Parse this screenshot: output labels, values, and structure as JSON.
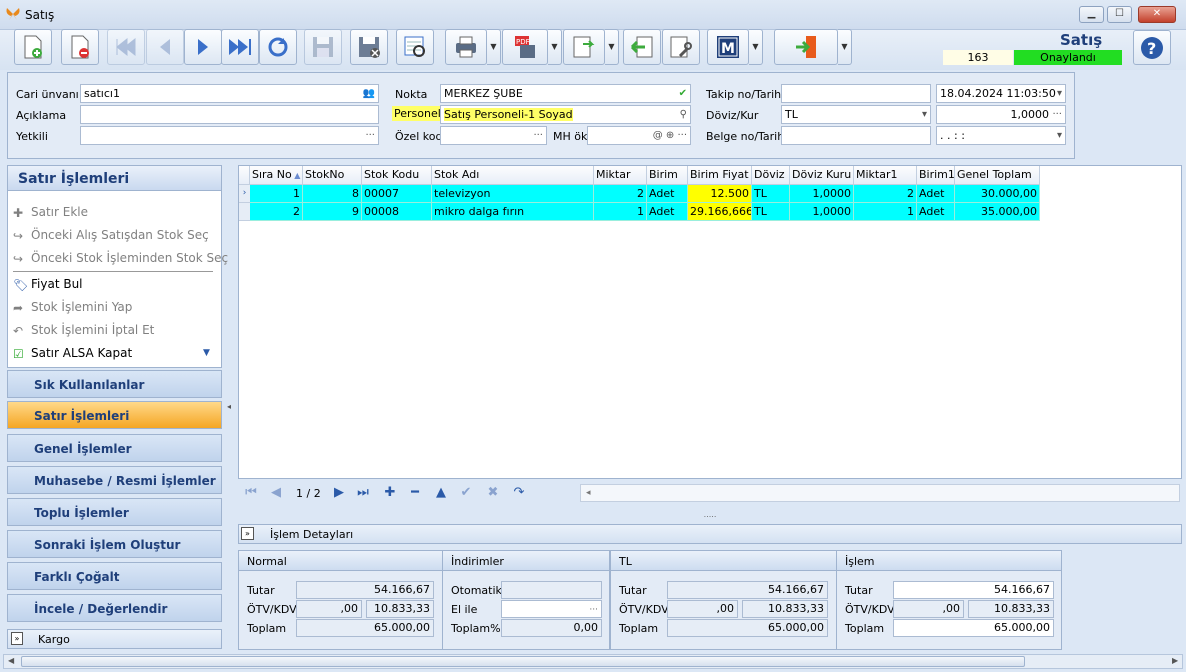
{
  "window": {
    "title": "Satış",
    "minimize": "▁",
    "maximize": "☐",
    "close": "✕"
  },
  "form_title": "Satış",
  "record_count": "163",
  "status": "Onaylandı",
  "header": {
    "cari_label": "Cari ünvanı",
    "cari_value": "satıcı1",
    "aciklama_label": "Açıklama",
    "aciklama_value": "",
    "yetkili_label": "Yetkili",
    "yetkili_value": "",
    "nokta_label": "Nokta",
    "nokta_value": "MERKEZ ŞUBE",
    "personel_label": "Personel",
    "personel_value": "Satış Personeli-1 Soyad",
    "ozel_kod_label": "Özel kod",
    "ozel_kod_value": "",
    "mh_ok_label": "MH ök",
    "mh_ok_value": "",
    "takip_label": "Takip no/Tarih",
    "takip_value": "",
    "takip_date": "18.04.2024 11:03:50",
    "doviz_label": "Döviz/Kur",
    "doviz_value": "TL",
    "kur_value": "1,0000",
    "belge_label": "Belge no/Tarih",
    "belge_value": "",
    "belge_date": ".  .      :  :"
  },
  "left_panel": {
    "title": "Satır İşlemleri",
    "items": [
      {
        "label": "Satır Ekle",
        "icon": "plus-icon",
        "enabled": false
      },
      {
        "label": "Önceki Alış Satışdan Stok Seç",
        "icon": "return-arrow-icon",
        "enabled": false
      },
      {
        "label": "Önceki Stok İşleminden Stok Seç",
        "icon": "return-arrow-icon",
        "enabled": false
      },
      {
        "label": "Fiyat Bul",
        "icon": "price-tag-icon",
        "enabled": true
      },
      {
        "label": "Stok İşlemini Yap",
        "icon": "forward-arrow-icon",
        "enabled": false
      },
      {
        "label": "Stok İşlemini İptal Et",
        "icon": "undo-arrow-icon",
        "enabled": false
      },
      {
        "label": "Satır ALSA Kapat",
        "icon": "checklist-icon",
        "enabled": true
      }
    ],
    "categories": [
      "Sık Kullanılanlar",
      "Satır İşlemleri",
      "Genel İşlemler",
      "Muhasebe / Resmi İşlemler",
      "Toplu İşlemler",
      "Sonraki İşlem Oluştur",
      "Farklı Çoğalt",
      "İncele / Değerlendir"
    ],
    "active_category": "Satır İşlemleri",
    "kargo": "Kargo"
  },
  "grid": {
    "columns": [
      "Sıra No",
      "StokNo",
      "Stok Kodu",
      "Stok Adı",
      "Miktar",
      "Birim",
      "Birim Fiyat",
      "Döviz",
      "Döviz Kuru",
      "Miktar1",
      "Birim1",
      "Genel Toplam"
    ],
    "rows": [
      [
        "1",
        "8",
        "00007",
        "televizyon",
        "2",
        "Adet",
        "12.500",
        "TL",
        "1,0000",
        "2",
        "Adet",
        "30.000,00"
      ],
      [
        "2",
        "9",
        "00008",
        "mikro dalga fırın",
        "1",
        "Adet",
        "29.166,6666",
        "TL",
        "1,0000",
        "1",
        "Adet",
        "35.000,00"
      ]
    ],
    "pager": "1 / 2"
  },
  "details": {
    "bar_label": "İşlem Detayları",
    "normal": {
      "title": "Normal",
      "tutar_label": "Tutar",
      "tutar": "54.166,67",
      "otv_label": "ÖTV/KDV",
      "otv": ",00",
      "kdv": "10.833,33",
      "toplam_label": "Toplam",
      "toplam": "65.000,00"
    },
    "indirimler": {
      "title": "İndirimler",
      "otomatik_label": "Otomatik",
      "otomatik": "",
      "elile_label": "El ile",
      "elile": "",
      "toplam_label": "Toplam%",
      "toplam": "0,00"
    },
    "tl": {
      "title": "TL",
      "tutar_label": "Tutar",
      "tutar": "54.166,67",
      "otv_label": "ÖTV/KDV",
      "otv": ",00",
      "kdv": "10.833,33",
      "toplam_label": "Toplam",
      "toplam": "65.000,00"
    },
    "islem": {
      "title": "İşlem",
      "tutar_label": "Tutar",
      "tutar": "54.166,67",
      "otv_label": "ÖTV/KDV",
      "otv": ",00",
      "kdv": "10.833,33",
      "toplam_label": "Toplam",
      "toplam": "65.000,00"
    }
  },
  "colors": {
    "row_highlight": "#00ffff",
    "price_cell": "#ffff00",
    "status_ok": "#22dd22",
    "accent": "#1f3f7a",
    "active_tab": "#f5a623"
  }
}
